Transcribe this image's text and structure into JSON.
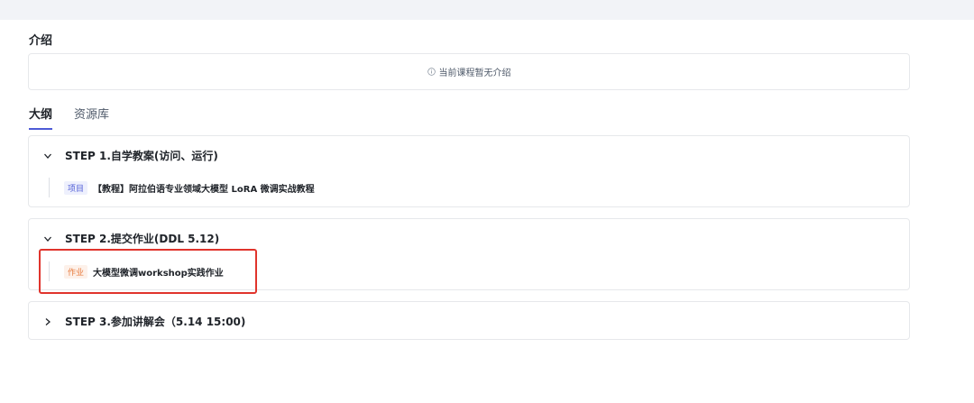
{
  "intro": {
    "title": "介绍",
    "empty_text": "当前课程暂无介绍"
  },
  "tabs": [
    {
      "label": "大纲",
      "active": true
    },
    {
      "label": "资源库",
      "active": false
    }
  ],
  "steps": [
    {
      "title": "STEP 1.自学教案(访问、运行)",
      "expanded": true,
      "item": {
        "tag": "项目",
        "text": "【教程】阿拉伯语专业领域大模型 LoRA 微调实战教程"
      }
    },
    {
      "title": "STEP 2.提交作业(DDL 5.12)",
      "expanded": true,
      "item": {
        "tag": "作业",
        "text": "大模型微调workshop实践作业"
      }
    },
    {
      "title": "STEP 3.参加讲解会（5.14 15:00)",
      "expanded": false
    }
  ],
  "colors": {
    "accent": "#4e5bd6",
    "highlight": "#e0342c",
    "homework_tag": "#e87b3e"
  }
}
